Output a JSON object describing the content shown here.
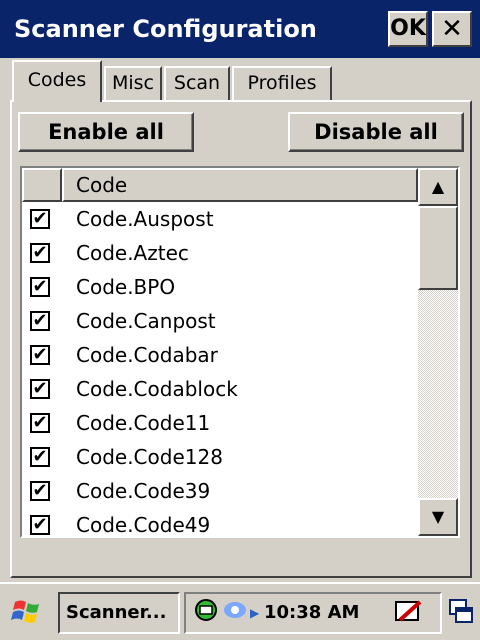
{
  "window": {
    "title": "Scanner Configuration",
    "ok_label": "OK",
    "close_label": "✕"
  },
  "tabs": [
    {
      "label": "Codes",
      "active": true
    },
    {
      "label": "Misc",
      "active": false
    },
    {
      "label": "Scan",
      "active": false
    },
    {
      "label": "Profiles",
      "active": false
    }
  ],
  "buttons": {
    "enable_all": "Enable all",
    "disable_all": "Disable all"
  },
  "list": {
    "column_header": "Code",
    "rows": [
      {
        "label": "Code.Auspost",
        "checked": true
      },
      {
        "label": "Code.Aztec",
        "checked": true
      },
      {
        "label": "Code.BPO",
        "checked": true
      },
      {
        "label": "Code.Canpost",
        "checked": true
      },
      {
        "label": "Code.Codabar",
        "checked": true
      },
      {
        "label": "Code.Codablock",
        "checked": true
      },
      {
        "label": "Code.Code11",
        "checked": true
      },
      {
        "label": "Code.Code128",
        "checked": true
      },
      {
        "label": "Code.Code39",
        "checked": true
      },
      {
        "label": "Code.Code49",
        "checked": true
      }
    ],
    "checkmark": "✔",
    "scroll_up_icon": "▲",
    "scroll_down_icon": "▼"
  },
  "taskbar": {
    "start_icon": "windows-flag-icon",
    "task_label": "Scanner...",
    "clock": "10:38 AM",
    "icons": [
      "network-icon",
      "sync-icon",
      "pen-input-icon",
      "window-switch-icon"
    ]
  },
  "colors": {
    "titlebar": "#0a246a",
    "face": "#d4d0c8"
  }
}
